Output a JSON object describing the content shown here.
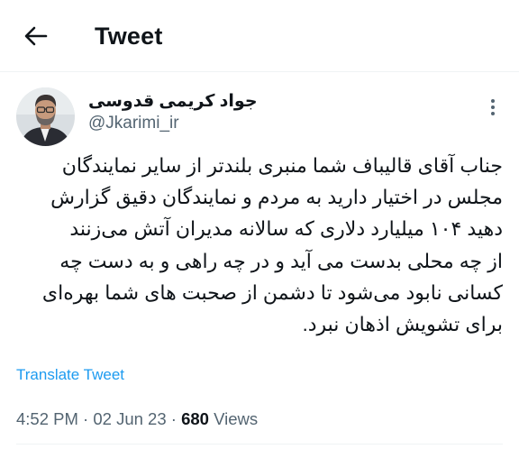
{
  "header": {
    "back_icon": "arrow-left-icon",
    "title": "Tweet"
  },
  "author": {
    "name": "جواد کریمی قدوسی",
    "handle": "@Jkarimi_ir",
    "avatar_icon": "avatar-photo",
    "more_icon": "more-vertical-icon"
  },
  "tweet": {
    "lines": [
      "جناب آقای قالیباف شما منبری بلندتر از سایر نمایندگان",
      "مجلس در اختیار دارید به مردم و نمایندگان دقیق گزارش",
      "دهید ۱۰۴ میلیارد دلاری که سالانه مدیران آتش می‌زنند",
      "از چه محلی بدست می آید و در چه راهی و به دست چه",
      "کسانی نابود می‌شود تا دشمن از صحبت های شما بهره‌ای",
      "برای تشویش اذهان نبرد."
    ],
    "translate_label": "Translate Tweet"
  },
  "meta": {
    "time": "4:52 PM",
    "date": "02 Jun 23",
    "separator": "·",
    "views_count": "680",
    "views_label": "Views"
  },
  "colors": {
    "text": "#0f1419",
    "secondary": "#536471",
    "link": "#1d9bf0",
    "divider": "#eff3f4"
  }
}
